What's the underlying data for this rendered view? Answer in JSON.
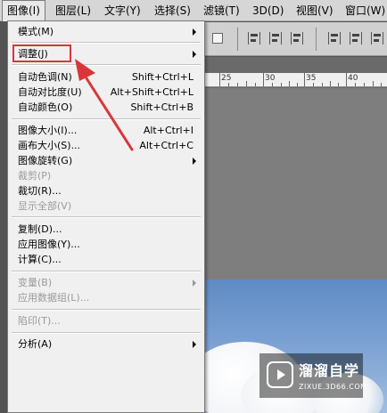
{
  "menubar": {
    "items": [
      {
        "label": "图像(I)",
        "active": true
      },
      {
        "label": "图层(L)"
      },
      {
        "label": "文字(Y)"
      },
      {
        "label": "选择(S)"
      },
      {
        "label": "滤镜(T)"
      },
      {
        "label": "3D(D)"
      },
      {
        "label": "视图(V)"
      },
      {
        "label": "窗口(W)"
      }
    ]
  },
  "ruler": {
    "labels": [
      "25",
      "30",
      "35",
      "40"
    ]
  },
  "image_menu": {
    "items": [
      {
        "label": "模式(M)",
        "shortcut": "",
        "submenu": true,
        "disabled": false
      },
      {
        "label": "调整(J)",
        "shortcut": "",
        "submenu": true,
        "disabled": false
      },
      {
        "label": "自动色调(N)",
        "shortcut": "Shift+Ctrl+L",
        "submenu": false,
        "disabled": false
      },
      {
        "label": "自动对比度(U)",
        "shortcut": "Alt+Shift+Ctrl+L",
        "submenu": false,
        "disabled": false
      },
      {
        "label": "自动颜色(O)",
        "shortcut": "Shift+Ctrl+B",
        "submenu": false,
        "disabled": false
      },
      {
        "label": "图像大小(I)...",
        "shortcut": "Alt+Ctrl+I",
        "submenu": false,
        "disabled": false
      },
      {
        "label": "画布大小(S)...",
        "shortcut": "Alt+Ctrl+C",
        "submenu": false,
        "disabled": false
      },
      {
        "label": "图像旋转(G)",
        "shortcut": "",
        "submenu": true,
        "disabled": false
      },
      {
        "label": "裁剪(P)",
        "shortcut": "",
        "submenu": false,
        "disabled": true
      },
      {
        "label": "裁切(R)...",
        "shortcut": "",
        "submenu": false,
        "disabled": false
      },
      {
        "label": "显示全部(V)",
        "shortcut": "",
        "submenu": false,
        "disabled": true
      },
      {
        "label": "复制(D)...",
        "shortcut": "",
        "submenu": false,
        "disabled": false
      },
      {
        "label": "应用图像(Y)...",
        "shortcut": "",
        "submenu": false,
        "disabled": false
      },
      {
        "label": "计算(C)...",
        "shortcut": "",
        "submenu": false,
        "disabled": false
      },
      {
        "label": "变量(B)",
        "shortcut": "",
        "submenu": true,
        "disabled": true
      },
      {
        "label": "应用数据组(L)...",
        "shortcut": "",
        "submenu": false,
        "disabled": true
      },
      {
        "label": "陷印(T)...",
        "shortcut": "",
        "submenu": false,
        "disabled": true
      },
      {
        "label": "分析(A)",
        "shortcut": "",
        "submenu": true,
        "disabled": false
      }
    ]
  },
  "annotation": {
    "highlight_color": "#d8363b"
  },
  "watermark": {
    "title": "溜溜自学",
    "subtitle": "ZIXUE.3D66.COM"
  }
}
